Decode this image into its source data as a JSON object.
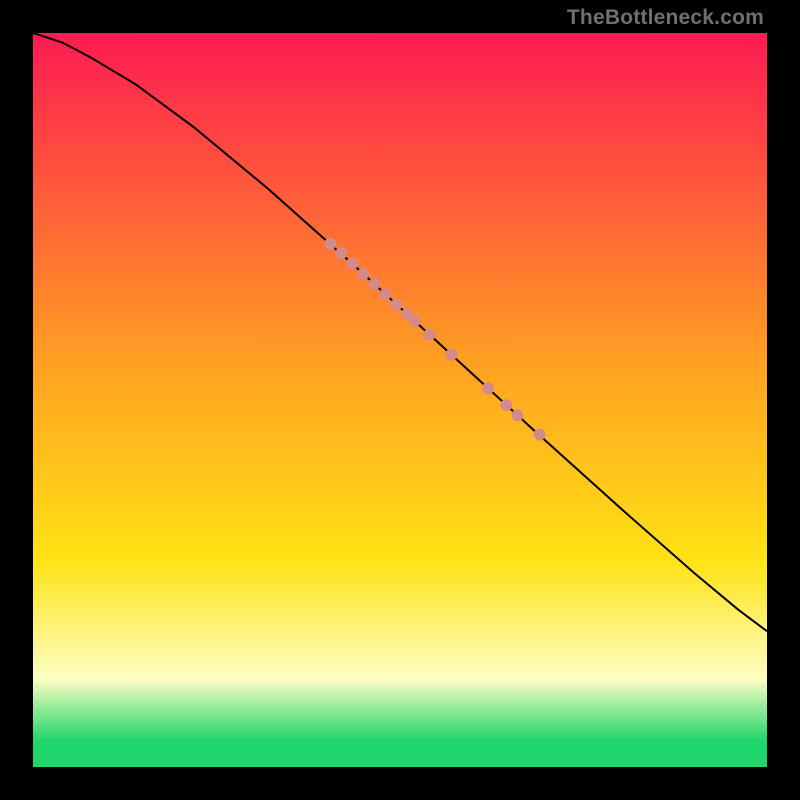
{
  "watermark": "TheBottleneck.com",
  "colors": {
    "magenta": "#ff1a52",
    "orange": "#ffa022",
    "yellow": "#ffe315",
    "pale": "#fdfec4",
    "green": "#1ed66a",
    "point": "#d58a8a",
    "curve": "#000000",
    "frame": "#000000"
  },
  "chart_data": {
    "type": "line",
    "title": "",
    "xlabel": "",
    "ylabel": "",
    "xlim": [
      0,
      100
    ],
    "ylim": [
      0,
      100
    ],
    "grid": false,
    "legend": false,
    "series": [
      {
        "name": "curve",
        "x": [
          0,
          4,
          8,
          14,
          22,
          32,
          44,
          56,
          68,
          80,
          90,
          96,
          100
        ],
        "y": [
          100,
          98.7,
          96.6,
          93.0,
          87.1,
          78.8,
          68.1,
          57.1,
          46.1,
          35.3,
          26.5,
          21.5,
          18.5
        ]
      }
    ],
    "points": {
      "name": "markers",
      "xy": [
        [
          40.5,
          71.3
        ],
        [
          42.0,
          70.0
        ],
        [
          43.5,
          68.6
        ],
        [
          45.0,
          67.2
        ],
        [
          46.5,
          65.8
        ],
        [
          48.0,
          64.4
        ],
        [
          49.5,
          63.0
        ],
        [
          51.0,
          61.7
        ],
        [
          52.0,
          60.8
        ],
        [
          54.0,
          58.9
        ],
        [
          57.0,
          56.2
        ],
        [
          62.0,
          51.6
        ],
        [
          64.5,
          49.3
        ],
        [
          66.0,
          47.9
        ],
        [
          69.0,
          45.3
        ]
      ]
    },
    "gradient_stops": [
      {
        "offset": 0.0,
        "key": "magenta"
      },
      {
        "offset": 0.45,
        "key": "orange"
      },
      {
        "offset": 0.72,
        "key": "yellow"
      },
      {
        "offset": 0.88,
        "key": "pale"
      },
      {
        "offset": 0.965,
        "key": "green"
      },
      {
        "offset": 1.0,
        "key": "green"
      }
    ]
  }
}
